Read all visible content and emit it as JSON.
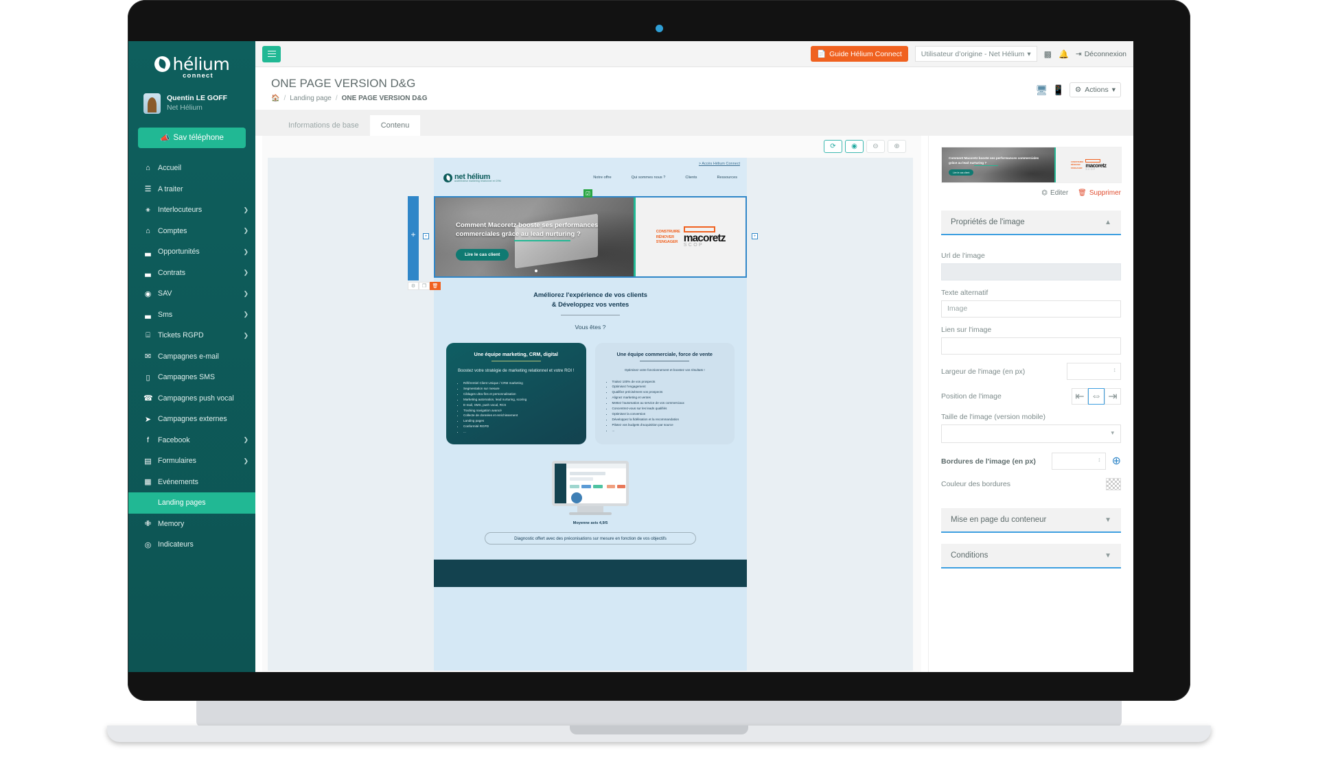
{
  "sidebar": {
    "logo": {
      "name": "hélium",
      "sub": "connect"
    },
    "user": {
      "name": "Quentin LE GOFF",
      "org": "Net Hélium"
    },
    "sav_button": "Sav téléphone",
    "items": [
      {
        "label": "Accueil",
        "icon": "home-icon",
        "glyph": "⌂",
        "chevron": false,
        "active": false
      },
      {
        "label": "A traiter",
        "icon": "list-icon",
        "glyph": "☰",
        "chevron": false,
        "active": false
      },
      {
        "label": "Interlocuteurs",
        "icon": "user-icon",
        "glyph": "⚹",
        "chevron": true,
        "active": false
      },
      {
        "label": "Comptes",
        "icon": "building-icon",
        "glyph": "⌂",
        "chevron": true,
        "active": false
      },
      {
        "label": "Opportunités",
        "icon": "chart-bars-icon",
        "glyph": "▃",
        "chevron": true,
        "active": false
      },
      {
        "label": "Contrats",
        "icon": "chart-bars-icon",
        "glyph": "▃",
        "chevron": true,
        "active": false
      },
      {
        "label": "SAV",
        "icon": "lifebuoy-icon",
        "glyph": "◉",
        "chevron": true,
        "active": false
      },
      {
        "label": "Sms",
        "icon": "chart-bars-icon",
        "glyph": "▃",
        "chevron": true,
        "active": false
      },
      {
        "label": "Tickets RGPD",
        "icon": "database-icon",
        "glyph": "⌸",
        "chevron": true,
        "active": false
      },
      {
        "label": "Campagnes e-mail",
        "icon": "envelope-icon",
        "glyph": "✉",
        "chevron": false,
        "active": false
      },
      {
        "label": "Campagnes SMS",
        "icon": "mobile-icon",
        "glyph": "▯",
        "chevron": false,
        "active": false
      },
      {
        "label": "Campagnes push vocal",
        "icon": "phone-icon",
        "glyph": "☎",
        "chevron": false,
        "active": false
      },
      {
        "label": "Campagnes externes",
        "icon": "paper-plane-icon",
        "glyph": "➤",
        "chevron": false,
        "active": false
      },
      {
        "label": "Facebook",
        "icon": "facebook-icon",
        "glyph": "f",
        "chevron": true,
        "active": false
      },
      {
        "label": "Formulaires",
        "icon": "form-icon",
        "glyph": "▤",
        "chevron": true,
        "active": false
      },
      {
        "label": "Evénements",
        "icon": "calendar-icon",
        "glyph": "▦",
        "chevron": false,
        "active": false
      },
      {
        "label": "Landing pages",
        "icon": "code-icon",
        "glyph": "</>",
        "chevron": false,
        "active": true
      },
      {
        "label": "Memory",
        "icon": "puzzle-icon",
        "glyph": "✙",
        "chevron": false,
        "active": false
      },
      {
        "label": "Indicateurs",
        "icon": "gauge-icon",
        "glyph": "◎",
        "chevron": false,
        "active": false
      }
    ]
  },
  "topbar": {
    "menu_toggle": "menu-toggle",
    "guide_button": "Guide Hélium Connect",
    "user_select": "Utilisateur d’origine - Net Hélium",
    "logout": "Déconnexion"
  },
  "page": {
    "title": "ONE PAGE VERSION D&G",
    "breadcrumb": {
      "home": "⌂",
      "parent": "Landing page",
      "current": "ONE PAGE VERSION D&G"
    },
    "actions_button": "Actions"
  },
  "tabs": [
    {
      "label": "Informations de base",
      "active": false
    },
    {
      "label": "Contenu",
      "active": true
    }
  ],
  "canvas_toolbar": [
    {
      "name": "refresh-icon",
      "glyph": "⟳",
      "active": true
    },
    {
      "name": "eye-icon",
      "glyph": "◉",
      "active": true
    },
    {
      "name": "zoom-out-icon",
      "glyph": "⊖",
      "active": false
    },
    {
      "name": "zoom-in-icon",
      "glyph": "⊕",
      "active": false
    }
  ],
  "landing_page": {
    "access_link": "> Accès Hélium Connect",
    "logo": {
      "name": "net hélium",
      "tagline": "accélérateur marketing relationnel et CRM"
    },
    "menu": [
      "Notre offre",
      "Qui sommes nous ?",
      "Clients",
      "Ressources"
    ],
    "hero": {
      "headline": "Comment Macoretz booste ses performances commerciales grâce au lead nurturing ?",
      "cta": "Lire le cas client",
      "brand": {
        "words": [
          "CONSTRUIRE",
          "RÉNOVER",
          "S'ENGAGER"
        ],
        "name": "macoretz",
        "scop": "SCOP"
      }
    },
    "subtitle_line1": "Améliorez l'expérience de vos clients",
    "subtitle_line2": "& Développez vos ventes",
    "question": "Vous êtes ?",
    "cards": [
      {
        "title": "Une équipe marketing, CRM, digital",
        "lead": "Boostez votre stratégie de marketing relationnel et votre ROI !",
        "items": [
          "Référentiel Client Unique / CRM marketing",
          "Segmentation sur mesure",
          "Ciblages ultra-fins et personnalisation",
          "Marketing automation, lead nurturing, scoring",
          "E-mail, SMS, push vocal, RCS",
          "Tracking navigation avancé",
          "Collecte de données et enrichissement",
          "Landing pages",
          "Conformité RGPD",
          "..."
        ]
      },
      {
        "title": "Une équipe commerciale, force de vente",
        "lead": "Optimisez votre fonctionnement et boostez vos résultats !",
        "items": [
          "Traitez 100% de vos prospects",
          "Optimisez l'engagement",
          "Qualifiez précisément vos prospects",
          "Alignez marketing et ventes",
          "Mettez l'automation au service de vos commerciaux",
          "Concentrez-vous sur les leads qualifiés",
          "Optimisez la conversion",
          "Développez la fidélisation et la recommandation",
          "Pilotez vos budgets d'acquisition par source",
          "..."
        ]
      }
    ],
    "rating": "Moyenne avis 4,9/5",
    "diagnostic_pill": "Diagnostic offert avec des préconisations sur mesure en fonction de vos objectifs"
  },
  "properties_panel": {
    "thumbnail": {
      "headline": "Comment Macoretz booste ses performances commerciales grâce au lead nurturing ?",
      "cta": "Lire le cas client",
      "brand_words": [
        "CONSTRUIRE",
        "RÉNOVER",
        "S'ENGAGER"
      ],
      "brand_name": "macoretz",
      "brand_scop": "SCOP"
    },
    "edit_label": "Editer",
    "delete_label": "Supprimer",
    "section_image": "Propriétés de l'image",
    "fields": {
      "url_label": "Url de l'image",
      "url_value": "",
      "alt_label": "Texte alternatif",
      "alt_value": "Image",
      "link_label": "Lien sur l'image",
      "link_value": "",
      "width_label": "Largeur de l'image (en px)",
      "width_value": "",
      "position_label": "Position de l'image",
      "position_options": [
        "align-left",
        "align-center",
        "align-right"
      ],
      "position_selected": "align-center",
      "mobile_size_label": "Taille de l'image (version mobile)",
      "mobile_size_value": "",
      "borders_label": "Bordures de l'image (en px)",
      "borders_value": "",
      "border_color_label": "Couleur des bordures"
    },
    "section_container": "Mise en page du conteneur",
    "section_conditions": "Conditions"
  },
  "colors": {
    "sidebar": "#0d5c5c",
    "accent_green": "#21b894",
    "orange": "#f0611f",
    "blue": "#3d9fe0",
    "lp_background": "#d5e8f5"
  }
}
